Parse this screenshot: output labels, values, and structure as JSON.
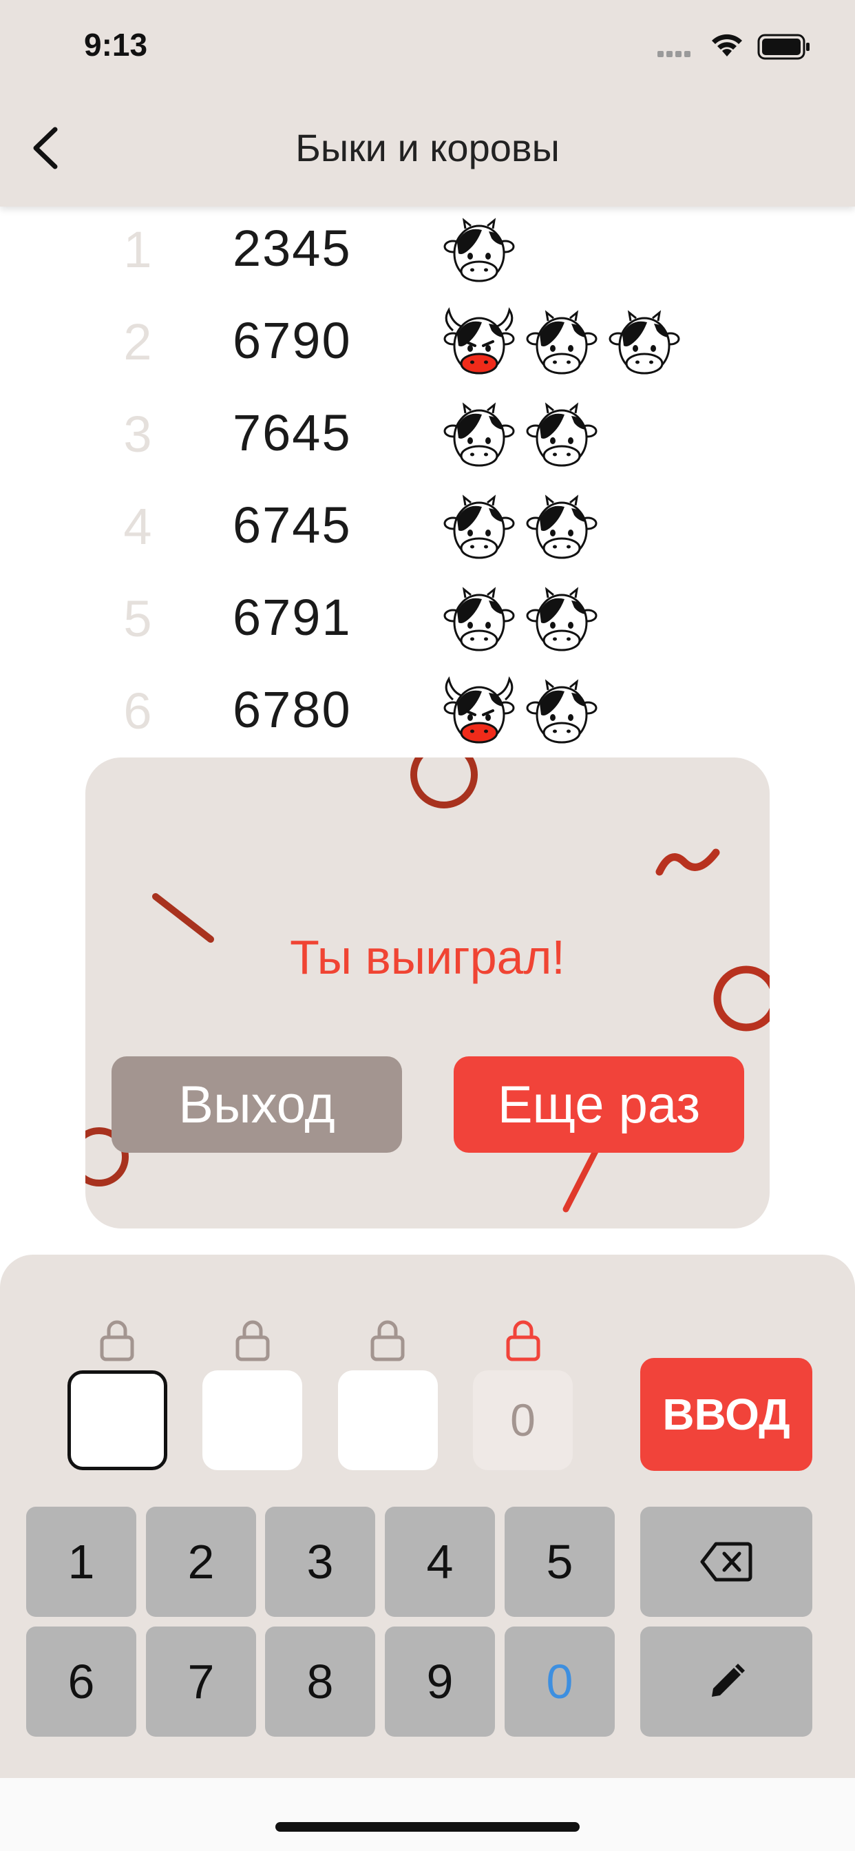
{
  "status": {
    "time": "9:13"
  },
  "nav": {
    "title": "Быки и коровы"
  },
  "guesses": [
    {
      "index": "1",
      "number": "2345",
      "bulls": 0,
      "cows": 1
    },
    {
      "index": "2",
      "number": "6790",
      "bulls": 1,
      "cows": 2
    },
    {
      "index": "3",
      "number": "7645",
      "bulls": 0,
      "cows": 2
    },
    {
      "index": "4",
      "number": "6745",
      "bulls": 0,
      "cows": 2
    },
    {
      "index": "5",
      "number": "6791",
      "bulls": 0,
      "cows": 2
    },
    {
      "index": "6",
      "number": "6780",
      "bulls": 1,
      "cows": 1
    }
  ],
  "dialog": {
    "message": "Ты выиграл!",
    "exit_label": "Выход",
    "again_label": "Еще раз"
  },
  "input": {
    "slots": [
      "",
      "",
      "",
      "0"
    ],
    "enter_label": "ВВОД"
  },
  "keys": {
    "row1": [
      "1",
      "2",
      "3",
      "4",
      "5"
    ],
    "row2": [
      "6",
      "7",
      "8",
      "9",
      "0"
    ]
  },
  "colors": {
    "accent": "#f1433a",
    "neutral_button": "#a39590",
    "background": "#e8e2de",
    "key": "#b5b5b5",
    "zero_key_text": "#3d8fe0"
  }
}
